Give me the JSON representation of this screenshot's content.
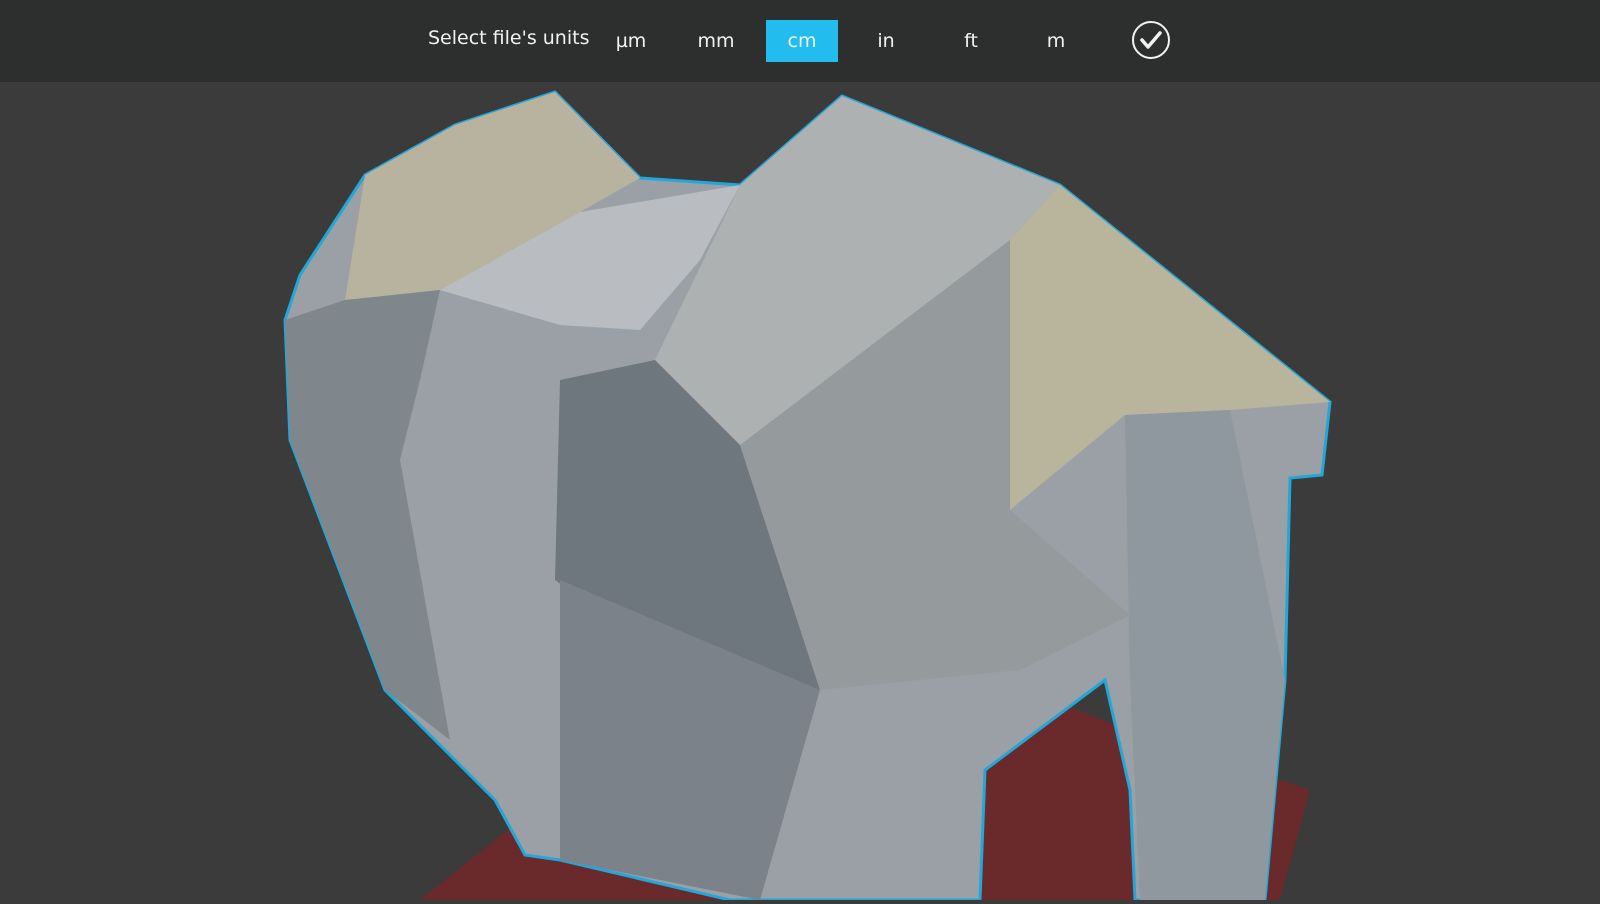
{
  "toolbar": {
    "title": "Select file's units",
    "units": [
      "µm",
      "mm",
      "cm",
      "in",
      "ft",
      "m"
    ],
    "selected_unit": "cm",
    "confirm_icon": "checkmark-circle-icon"
  },
  "colors": {
    "accent": "#22bdee",
    "bar": "#2d2e2e",
    "viewport": "#3b3b3b",
    "model": "#9aa0a6",
    "highlight": "#22a7d8",
    "base": "#6a2a2c"
  }
}
